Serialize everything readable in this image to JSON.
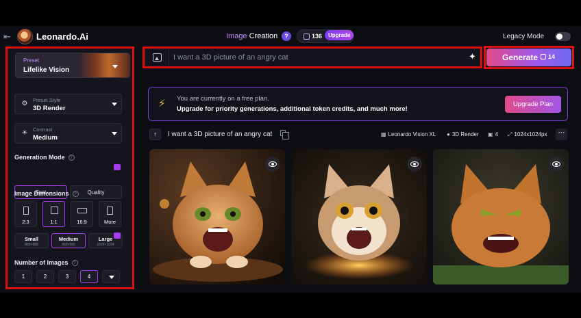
{
  "header": {
    "brand": "Leonardo.Ai",
    "title_first": "Image",
    "title_second": " Creation",
    "token_count": "136",
    "upgrade_label": "Upgrade",
    "legacy_mode_label": "Legacy Mode",
    "legacy_mode_on": false
  },
  "sidebar": {
    "preset": {
      "label": "Preset",
      "value": "Lifelike Vision"
    },
    "preset_style": {
      "label": "Preset Style",
      "value": "3D Render"
    },
    "contrast": {
      "label": "Contrast",
      "value": "Medium"
    },
    "generation_mode": {
      "title": "Generation Mode",
      "options": [
        "Fast",
        "Quality"
      ],
      "selected": "Fast"
    },
    "image_dimensions": {
      "title": "Image Dimensions",
      "ratios": [
        "2:3",
        "1:1",
        "16:9",
        "More"
      ],
      "selected_ratio": "1:1",
      "sizes": [
        {
          "name": "Small",
          "dims": "888×888"
        },
        {
          "name": "Medium",
          "dims": "960×960"
        },
        {
          "name": "Large",
          "dims": "1024×1024"
        }
      ],
      "selected_size": "Medium"
    },
    "number_of_images": {
      "title": "Number of Images",
      "options": [
        "1",
        "2",
        "3",
        "4"
      ],
      "selected": "4"
    }
  },
  "prompt": {
    "placeholder": "I want a 3D picture of an angry cat",
    "value": ""
  },
  "generate": {
    "label": "Generate",
    "cost": "14"
  },
  "banner": {
    "line1": "You are currently on a free plan.",
    "line2": "Upgrade for priority generations, additional token credits, and much more!",
    "button": "Upgrade Plan"
  },
  "generation": {
    "prompt": "I want a 3D picture of an angry cat",
    "model": "Leonardo Vision XL",
    "style": "3D Render",
    "count": "4",
    "size": "1024x1024px"
  },
  "images": [
    {
      "description": "angry orange cat on wooden plate"
    },
    {
      "description": "shocked cat on glowing platform"
    },
    {
      "description": "snarling orange cat"
    }
  ],
  "colors": {
    "accent": "#a63ef0",
    "highlight": "#e01010",
    "brand_gradient_start": "#e24a8a"
  }
}
